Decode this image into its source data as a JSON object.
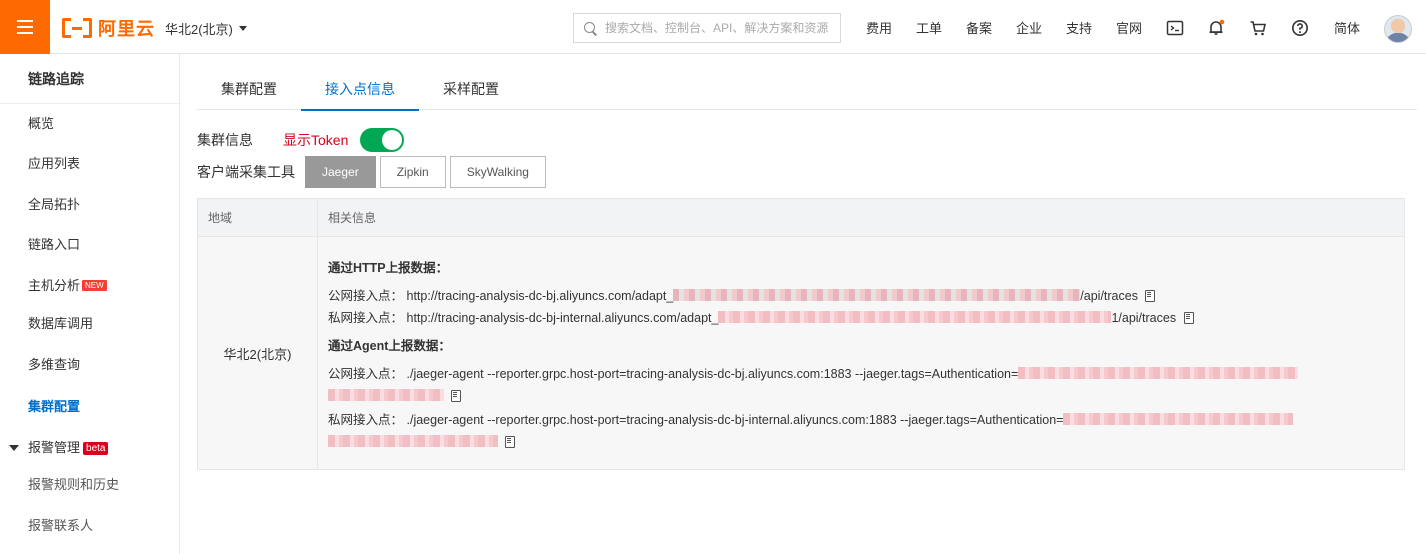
{
  "header": {
    "logo_text": "阿里云",
    "region": "华北2(北京)",
    "search_placeholder": "搜索文档、控制台、API、解决方案和资源",
    "nav": [
      "费用",
      "工单",
      "备案",
      "企业",
      "支持",
      "官网"
    ],
    "lang": "简体"
  },
  "sidebar": {
    "title": "链路追踪",
    "items": [
      {
        "label": "概览"
      },
      {
        "label": "应用列表"
      },
      {
        "label": "全局拓扑"
      },
      {
        "label": "链路入口"
      },
      {
        "label": "主机分析",
        "badge": "NEW"
      },
      {
        "label": "数据库调用"
      },
      {
        "label": "多维查询"
      },
      {
        "label": "集群配置",
        "active": true
      }
    ],
    "group": {
      "label": "报警管理",
      "badge": "beta"
    },
    "sub_items": [
      {
        "label": "报警规则和历史"
      },
      {
        "label": "报警联系人"
      }
    ]
  },
  "tabs": [
    {
      "label": "集群配置",
      "active": false
    },
    {
      "label": "接入点信息",
      "active": true
    },
    {
      "label": "采样配置",
      "active": false
    }
  ],
  "cluster": {
    "label": "集群信息",
    "token_label": "显示Token",
    "token_shown": true,
    "tool_label": "客户端采集工具",
    "tools": [
      {
        "label": "Jaeger",
        "active": true
      },
      {
        "label": "Zipkin",
        "active": false
      },
      {
        "label": "SkyWalking",
        "active": false
      }
    ]
  },
  "table": {
    "headers": [
      "地域",
      "相关信息"
    ],
    "region": "华北2(北京)",
    "http_title": "通过HTTP上报数据：",
    "http_public_label": "公网接入点：",
    "http_public_prefix": "http://tracing-analysis-dc-bj.aliyuncs.com/adapt_",
    "http_public_suffix": "/api/traces",
    "http_private_label": "私网接入点：",
    "http_private_prefix": "http://tracing-analysis-dc-bj-internal.aliyuncs.com/adapt_",
    "http_private_suffix": "1/api/traces",
    "agent_title": "通过Agent上报数据：",
    "agent_public_label": "公网接入点：",
    "agent_public_cmd": "./jaeger-agent --reporter.grpc.host-port=tracing-analysis-dc-bj.aliyuncs.com:1883 --jaeger.tags=Authentication=",
    "agent_private_label": "私网接入点：",
    "agent_private_cmd": "./jaeger-agent --reporter.grpc.host-port=tracing-analysis-dc-bj-internal.aliyuncs.com:1883 --jaeger.tags=Authentication="
  }
}
